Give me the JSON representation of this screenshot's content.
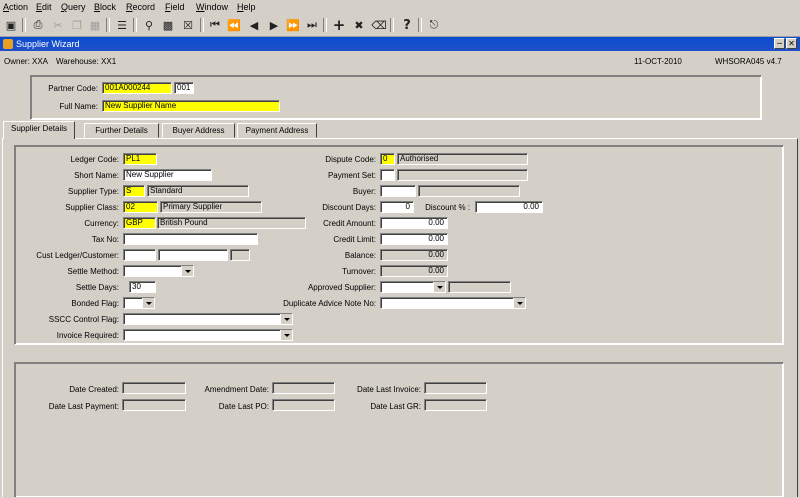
{
  "menu": {
    "items": [
      "Action",
      "Edit",
      "Query",
      "Block",
      "Record",
      "Field",
      "Window",
      "Help"
    ]
  },
  "toolbar": {
    "icons": [
      "save-icon",
      "print-icon",
      "cut-icon",
      "copy-icon",
      "paste-icon",
      "list-icon",
      "query-icon",
      "execute-icon",
      "cancel-query-icon",
      "first-record-icon",
      "previous-block-icon",
      "previous-record-icon",
      "next-record-icon",
      "next-block-icon",
      "last-record-icon",
      "insert-record-icon",
      "delete-record-icon",
      "clear-icon",
      "help-icon",
      "exit-icon"
    ]
  },
  "window": {
    "title": "Supplier Wizard"
  },
  "info": {
    "owner": "Owner: XXA",
    "warehouse": "Warehouse: XX1",
    "date": "11-OCT-2010",
    "module": "WHSORA045 v4.7"
  },
  "header": {
    "partner_code_label": "Partner Code:",
    "partner_code": "001A000244",
    "partner_code_suffix": "001",
    "full_name_label": "Full Name:",
    "full_name": "New Supplier Name"
  },
  "tabs": [
    "Supplier Details",
    "Further Details",
    "Buyer Address",
    "Payment Address"
  ],
  "details": {
    "ledger_code_label": "Ledger Code:",
    "ledger_code": "PL1",
    "short_name_label": "Short Name:",
    "short_name": "New Supplier",
    "supplier_type_label": "Supplier Type:",
    "supplier_type": "S",
    "supplier_type_desc": "Standard",
    "supplier_class_label": "Supplier Class:",
    "supplier_class": "02",
    "supplier_class_desc": "Primary Supplier",
    "currency_label": "Currency:",
    "currency": "GBP",
    "currency_desc": "British Pound",
    "tax_no_label": "Tax No:",
    "cust_ledger_label": "Cust Ledger/Customer:",
    "settle_method_label": "Settle Method:",
    "settle_days_label": "Settle Days:",
    "settle_days": "30",
    "bonded_flag_label": "Bonded Flag:",
    "sscc_label": "SSCC Control Flag:",
    "invoice_required_label": "Invoice Required:",
    "dispute_code_label": "Dispute Code:",
    "dispute_code": "0",
    "dispute_desc": "Authorised",
    "payment_set_label": "Payment Set:",
    "buyer_label": "Buyer:",
    "discount_days_label": "Discount Days:",
    "discount_days": "0",
    "discount_pct_label": "Discount % :",
    "discount_pct": "0.00",
    "credit_amount_label": "Credit Amount:",
    "credit_amount": "0.00",
    "credit_limit_label": "Credit Limit:",
    "credit_limit": "0.00",
    "balance_label": "Balance:",
    "balance": "0.00",
    "turnover_label": "Turnover:",
    "turnover": "0.00",
    "approved_supplier_label": "Approved Supplier:",
    "dup_advice_label": "Duplicate Advice Note No:"
  },
  "dates": {
    "date_created_label": "Date Created:",
    "amendment_date_label": "Amendment Date:",
    "date_last_invoice_label": "Date Last Invoice:",
    "date_last_payment_label": "Date Last Payment:",
    "date_last_po_label": "Date Last PO:",
    "date_last_gr_label": "Date Last GR:"
  }
}
